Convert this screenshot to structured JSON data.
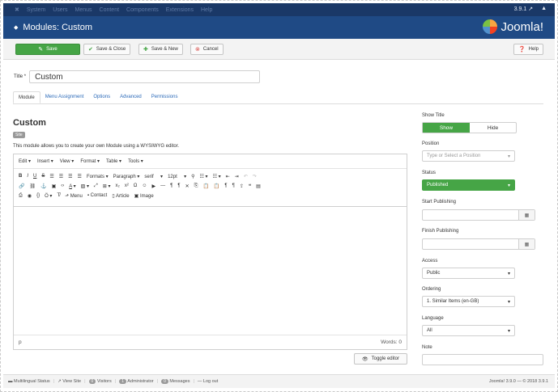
{
  "menubar": {
    "items": [
      "System",
      "Users",
      "Menus",
      "Content",
      "Components",
      "Extensions",
      "Help"
    ],
    "version": "3.9.1",
    "user_icon": "user-icon"
  },
  "header": {
    "title": "Modules: Custom",
    "logo": "Joomla!"
  },
  "toolbar": {
    "save": "Save",
    "save_close": "Save & Close",
    "save_new": "Save & New",
    "cancel": "Cancel",
    "help": "Help"
  },
  "title_field": {
    "label": "Title *",
    "value": "Custom"
  },
  "tabs": [
    "Module",
    "Menu Assignment",
    "Options",
    "Advanced",
    "Permissions"
  ],
  "module": {
    "heading": "Custom",
    "badge": "Site",
    "description": "This module allows you to create your own Module using a WYSIWYG editor."
  },
  "editor": {
    "menu": [
      "Edit",
      "Insert",
      "View",
      "Format",
      "Table",
      "Tools"
    ],
    "formats": "Formats",
    "paragraph": "Paragraph",
    "font": "serif",
    "size": "12pt",
    "row3": [
      "Menu",
      "Contact",
      "Article",
      "Image"
    ],
    "path": "p",
    "words": "Words: 0",
    "toggle": "Toggle editor"
  },
  "side": {
    "show_title": {
      "label": "Show Title",
      "on": "Show",
      "off": "Hide"
    },
    "position": {
      "label": "Position",
      "placeholder": "Type or Select a Position"
    },
    "status": {
      "label": "Status",
      "value": "Published"
    },
    "start": {
      "label": "Start Publishing"
    },
    "finish": {
      "label": "Finish Publishing"
    },
    "access": {
      "label": "Access",
      "value": "Public"
    },
    "ordering": {
      "label": "Ordering",
      "value": "1. Similar Items (en-GB)"
    },
    "language": {
      "label": "Language",
      "value": "All"
    },
    "note": {
      "label": "Note"
    }
  },
  "statusbar": {
    "multilingual": "Multilingual Status",
    "view_site": "View Site",
    "visitors_count": "0",
    "visitors": "Visitors",
    "admin_count": "1",
    "admin": "Administrator",
    "messages_count": "0",
    "messages": "Messages",
    "logout": "Log out",
    "footer": "Joomla! 3.9.0 — © 2018 3.9.1"
  },
  "colors": {
    "header": "#1f4a85",
    "menubar": "#1a3867",
    "green": "#46a546",
    "link": "#2a69b8"
  }
}
